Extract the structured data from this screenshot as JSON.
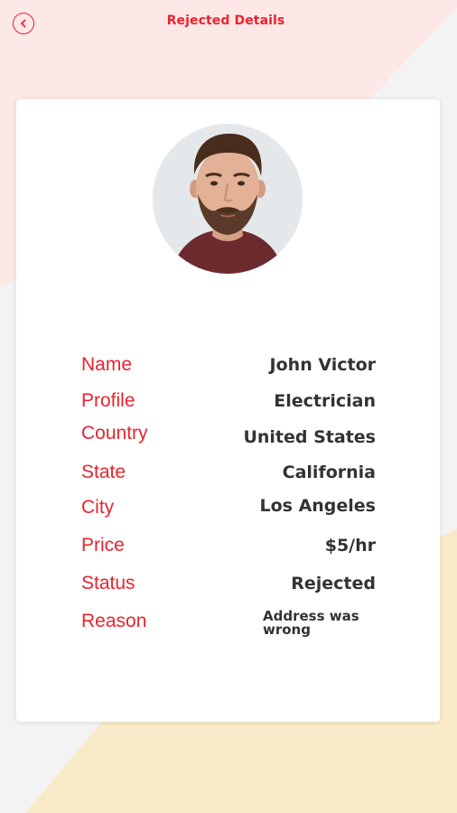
{
  "header": {
    "title": "Rejected Details",
    "back_icon": "back-arrow-circle-icon"
  },
  "colors": {
    "accent": "#e8242e",
    "value_text": "#333333",
    "bg_pink": "#fde7e7",
    "bg_cream": "#f9ebc9",
    "bg_gray": "#f3f3f3",
    "card": "#ffffff"
  },
  "profile": {
    "avatar": "user-avatar-photo",
    "details": [
      {
        "label": "Name",
        "value": "John Victor"
      },
      {
        "label": "Profile",
        "value": "Electrician"
      },
      {
        "label": "Country",
        "value": "United States"
      },
      {
        "label": "State",
        "value": "California"
      },
      {
        "label": "City",
        "value": "Los Angeles"
      },
      {
        "label": "Price",
        "value": "$5/hr"
      },
      {
        "label": "Status",
        "value": "Rejected"
      },
      {
        "label": "Reason",
        "value": "Address was wrong"
      }
    ]
  }
}
